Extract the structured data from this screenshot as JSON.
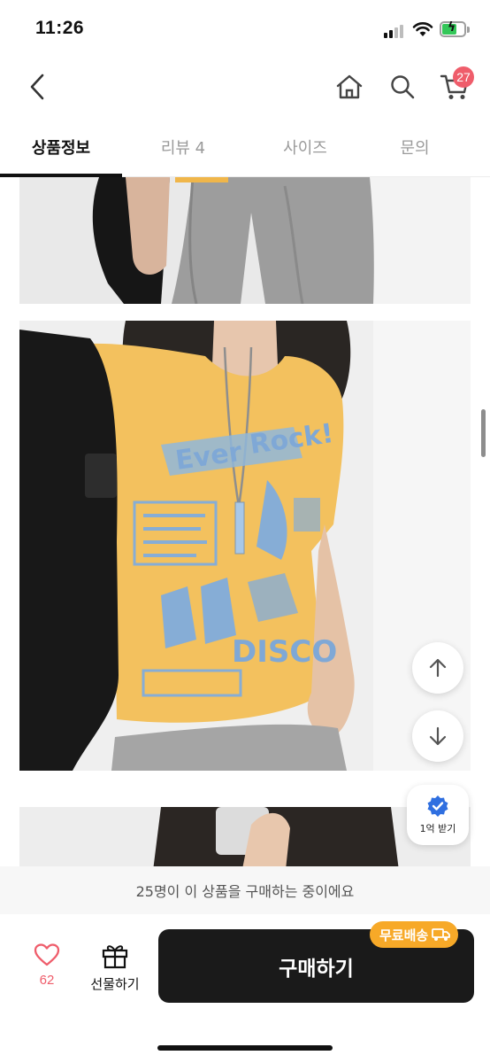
{
  "status_bar": {
    "time": "11:26"
  },
  "header": {
    "cart_count": "27"
  },
  "tabs": [
    {
      "label": "상품정보",
      "active": true
    },
    {
      "label": "리뷰 4",
      "active": false
    },
    {
      "label": "사이즈",
      "active": false
    },
    {
      "label": "문의",
      "active": false
    }
  ],
  "product_shirt_print": {
    "line1": "Ever",
    "line2": "Rock!",
    "line3": "DISCO"
  },
  "floating": {
    "coupon_label": "1억 받기"
  },
  "notice": {
    "text": "25명이 이 상품을 구매하는 중이에요"
  },
  "bottom": {
    "like_count": "62",
    "gift_label": "선물하기",
    "buy_label": "구매하기",
    "free_shipping_label": "무료배송"
  },
  "colors": {
    "accent_red": "#ef5d6b",
    "buy_button": "#1a1a1a",
    "free_shipping_badge": "#f7a928",
    "battery_green": "#34c759"
  }
}
